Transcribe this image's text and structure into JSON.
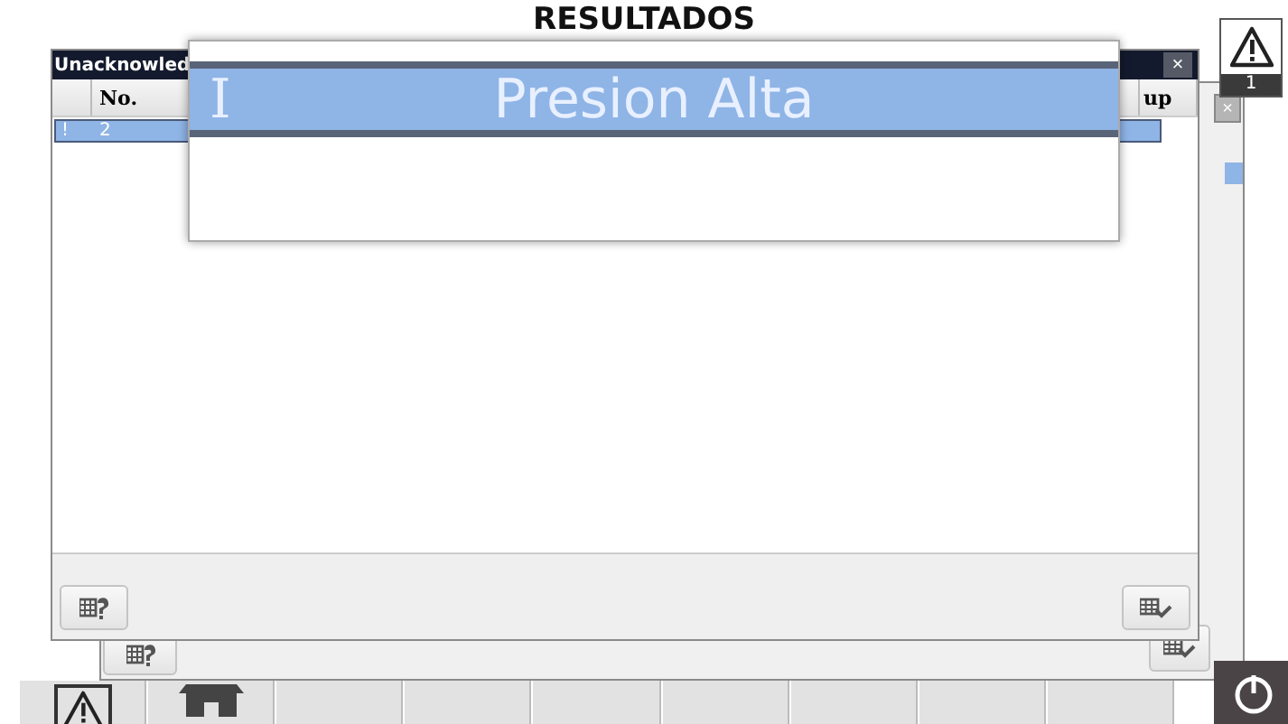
{
  "page_title": "RESULTADOS",
  "alarm_indicator": {
    "count": "1"
  },
  "back_window": {
    "close": "×",
    "rows": [
      {
        "selected": true
      }
    ]
  },
  "alarm_window": {
    "title": "Unacknowled",
    "close": "×",
    "columns": [
      {
        "label": "No."
      },
      {
        "label": "up"
      }
    ],
    "rows": [
      {
        "selected": true,
        "marker": "!",
        "cells": [
          "2"
        ]
      }
    ]
  },
  "popup": {
    "prefix": "I",
    "message": "Presion Alta"
  },
  "bottom_tabs": [
    {
      "kind": "alarm"
    },
    {
      "kind": "home"
    },
    {
      "kind": "empty"
    },
    {
      "kind": "empty"
    },
    {
      "kind": "empty"
    },
    {
      "kind": "empty"
    },
    {
      "kind": "empty"
    },
    {
      "kind": "empty"
    },
    {
      "kind": "empty"
    }
  ]
}
